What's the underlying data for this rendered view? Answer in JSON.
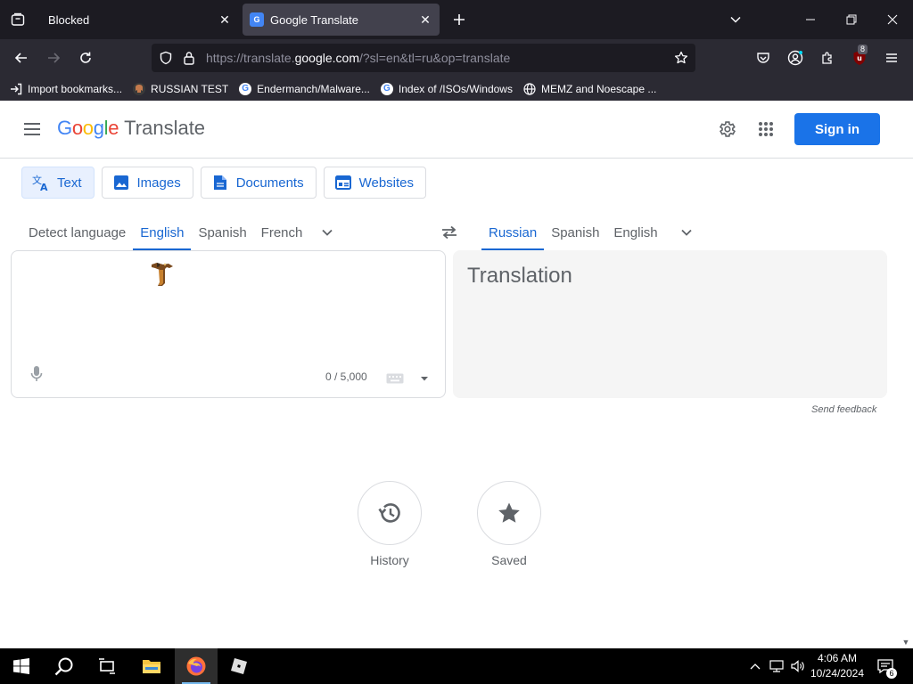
{
  "browser": {
    "tabs": [
      {
        "label": "Blocked",
        "active": false
      },
      {
        "label": "Google Translate",
        "active": true
      }
    ],
    "url": {
      "prefix": "https://translate.",
      "host": "google.com",
      "path": "/?sl=en&tl=ru&op=translate"
    },
    "extension_badge": "8",
    "bookmarks": [
      {
        "label": "Import bookmarks...",
        "icon": "import-icon"
      },
      {
        "label": "RUSSIAN TEST",
        "icon": "octocat-icon"
      },
      {
        "label": "Endermanch/Malware...",
        "icon": "google-icon"
      },
      {
        "label": "Index of /ISOs/Windows",
        "icon": "google-icon"
      },
      {
        "label": "MEMZ and Noescape ...",
        "icon": "globe-icon"
      }
    ]
  },
  "translate": {
    "logo_letters": [
      "G",
      "o",
      "o",
      "g",
      "l",
      "e"
    ],
    "logo_colors": [
      "#4285f4",
      "#ea4335",
      "#fbbc05",
      "#4285f4",
      "#34a853",
      "#ea4335"
    ],
    "product_name": "Translate",
    "sign_in": "Sign in",
    "modes": [
      {
        "label": "Text",
        "icon": "translate-icon",
        "active": true
      },
      {
        "label": "Images",
        "icon": "image-icon",
        "active": false
      },
      {
        "label": "Documents",
        "icon": "document-icon",
        "active": false
      },
      {
        "label": "Websites",
        "icon": "website-icon",
        "active": false
      }
    ],
    "source_langs": [
      "Detect language",
      "English",
      "Spanish",
      "French"
    ],
    "source_selected": "English",
    "target_langs": [
      "Russian",
      "Spanish",
      "English"
    ],
    "target_selected": "Russian",
    "char_count": "0 / 5,000",
    "translation_placeholder": "Translation",
    "send_feedback": "Send feedback",
    "history_label": "History",
    "saved_label": "Saved",
    "accent_color": "#1a73e8"
  },
  "taskbar": {
    "time": "4:06 AM",
    "date": "10/24/2024",
    "notification_count": "6"
  }
}
